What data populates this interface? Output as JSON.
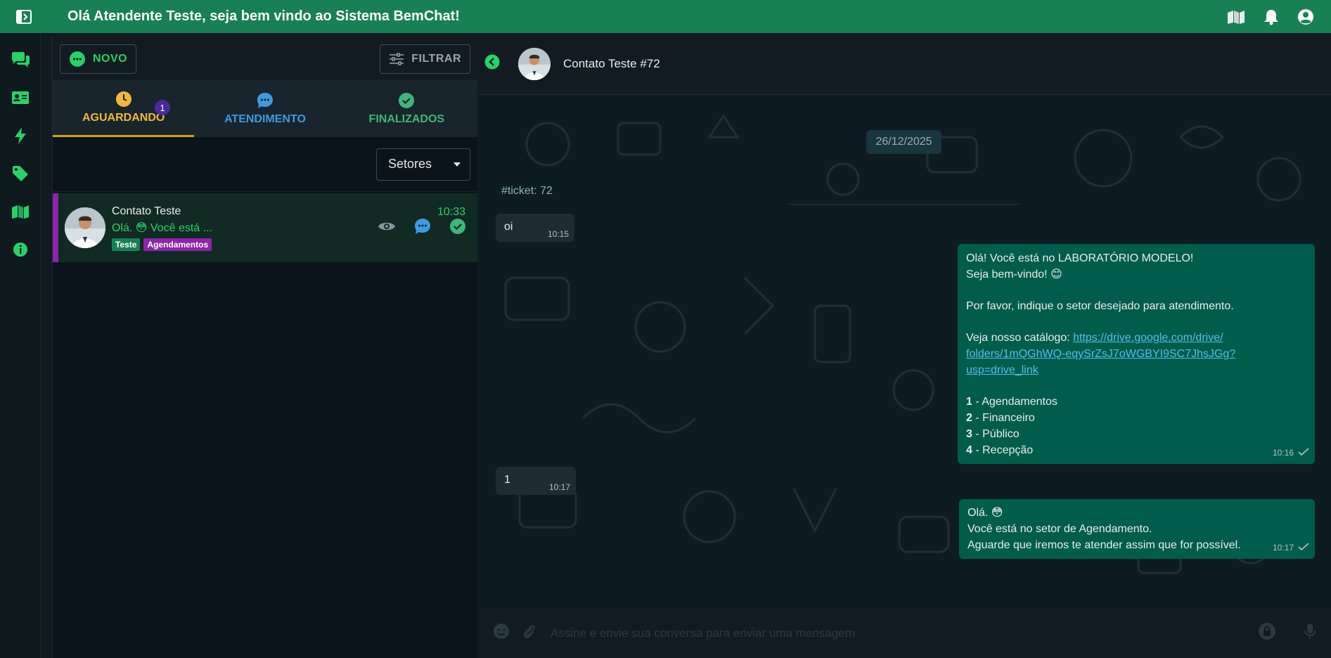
{
  "topbar": {
    "title": "Olá Atendente Teste, seja bem vindo ao Sistema BemChat!"
  },
  "toolbar": {
    "novo_label": "NOVO",
    "filtrar_label": "FILTRAR"
  },
  "tabs": {
    "aguardando": "AGUARDANDO",
    "aguardando_badge": "1",
    "atendimento": "ATENDIMENTO",
    "finalizados": "FINALIZADOS"
  },
  "filter": {
    "setores": "Setores"
  },
  "ticket": {
    "name": "Contato Teste",
    "preview": "Olá. 😳 Você está ...",
    "time": "10:33",
    "tags": [
      {
        "label": "Teste",
        "color": "#178154"
      },
      {
        "label": "Agendamentos",
        "color": "#8e24aa"
      }
    ]
  },
  "chat": {
    "contact_name": "Contato Teste #72",
    "date_chip": "26/12/2025",
    "ticket_label": "#ticket: 72",
    "messages": {
      "in1_text": "oi",
      "in1_time": "10:15",
      "out1_l1": "Olá! Você está no LABORATÓRIO MODELO!",
      "out1_l2": "Seja bem-vindo! 😊",
      "out1_l3": "Por favor, indique o setor desejado para atendimento.",
      "out1_l4_prefix": "Veja nosso catálogo: ",
      "out1_link1": "https://drive.google.com/drive/",
      "out1_link2": "folders/1mQGhWQ-eqySrZsJ7oWGBYI9SC7JhsJGg?",
      "out1_link3": "usp=drive_link",
      "opt1_num": "1",
      "opt1_text": " - Agendamentos",
      "opt2_num": "2",
      "opt2_text": " - Financeiro",
      "opt3_num": "3",
      "opt3_text": " - Público",
      "opt4_num": "4",
      "opt4_text": " - Recepção",
      "out1_time": "10:16",
      "in2_text": "1",
      "in2_time": "10:17",
      "out2_l1": "Olá. 😳",
      "out2_l2": "Você está no setor de Agendamento.",
      "out2_l3": "Aguarde que iremos te atender assim que for possível.",
      "out2_time": "10:17"
    },
    "composer_placeholder": "Assine e envie sua conversa para enviar uma mensagem"
  },
  "colors": {
    "brand": "#178154",
    "accent_green": "#25d366",
    "waiting": "#f0b83a",
    "in_service": "#3d9be0",
    "finished": "#3fb57a",
    "outgoing_bubble": "#005c4b"
  }
}
